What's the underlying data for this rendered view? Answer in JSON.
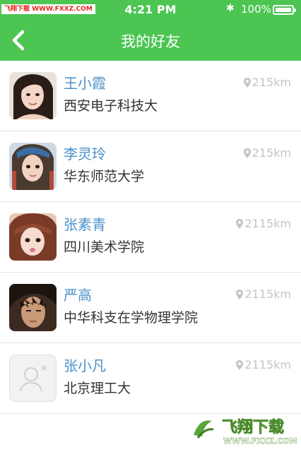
{
  "status_bar": {
    "watermark_tag": "飞翔下载 WWW.FXXZ.COM",
    "time": "4:21 PM",
    "bluetooth_glyph": "✱",
    "battery": "100%",
    "battery_level": 1.0
  },
  "nav": {
    "back_icon": "chevron-left-icon",
    "title": "我的好友"
  },
  "friends": [
    {
      "name": "王小霞",
      "school": "西安电子科技大",
      "distance": "215km",
      "avatar": "photo"
    },
    {
      "name": "李灵玲",
      "school": "华东师范大学",
      "distance": "215km",
      "avatar": "photo"
    },
    {
      "name": "张素青",
      "school": "四川美术学院",
      "distance": "2115km",
      "avatar": "photo"
    },
    {
      "name": "严高",
      "school": "中华科支在学物理学院",
      "distance": "2115km",
      "avatar": "photo"
    },
    {
      "name": "张小凡",
      "school": "北京理工大",
      "distance": "2115km",
      "avatar": "placeholder"
    }
  ],
  "watermark": {
    "brand": "飞翔下载",
    "url": "WWW.FXXZ.COM"
  },
  "colors": {
    "header_green": "#4cc553",
    "name_blue": "#4a90c9",
    "text_dark": "#333333",
    "distance_gray": "#c4c4c4",
    "divider": "#e3e3e3"
  }
}
